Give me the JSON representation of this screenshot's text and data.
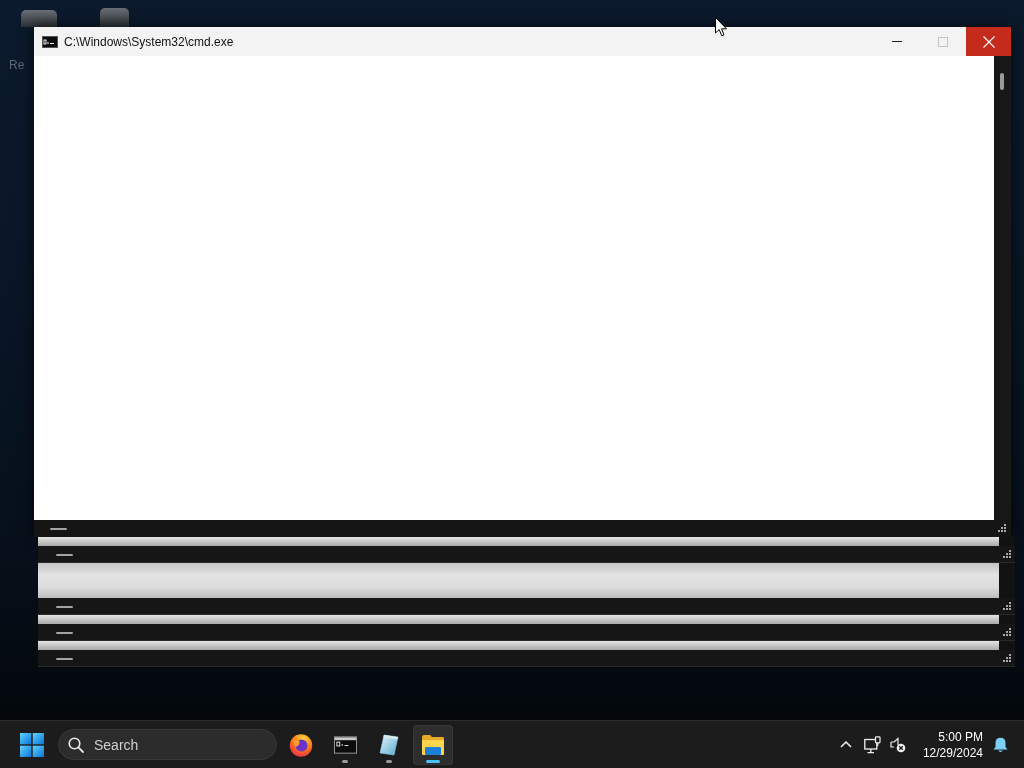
{
  "desktop": {
    "icon_label": "Re"
  },
  "window": {
    "title": "C:\\Windows\\System32\\cmd.exe",
    "controls": [
      {
        "kind": "minimize",
        "disabled": false
      },
      {
        "kind": "maximize",
        "disabled": true
      },
      {
        "kind": "close",
        "disabled": false
      }
    ],
    "ghost_trail": [
      {
        "kind": "strip"
      },
      {
        "kind": "scrollbar"
      },
      {
        "kind": "band"
      },
      {
        "kind": "scrollbar"
      },
      {
        "kind": "strip"
      },
      {
        "kind": "scrollbar"
      },
      {
        "kind": "strip"
      },
      {
        "kind": "scrollbar"
      }
    ]
  },
  "taskbar": {
    "search": {
      "placeholder": "Search"
    },
    "apps": [
      {
        "kind": "browser",
        "running": false,
        "selected": false
      },
      {
        "kind": "terminal",
        "running": true,
        "selected": false
      },
      {
        "kind": "notepad",
        "running": true,
        "selected": false
      },
      {
        "kind": "folder",
        "running": true,
        "selected": true
      }
    ],
    "tray": {
      "time": "5:00 PM",
      "date": "12/29/2024"
    }
  }
}
